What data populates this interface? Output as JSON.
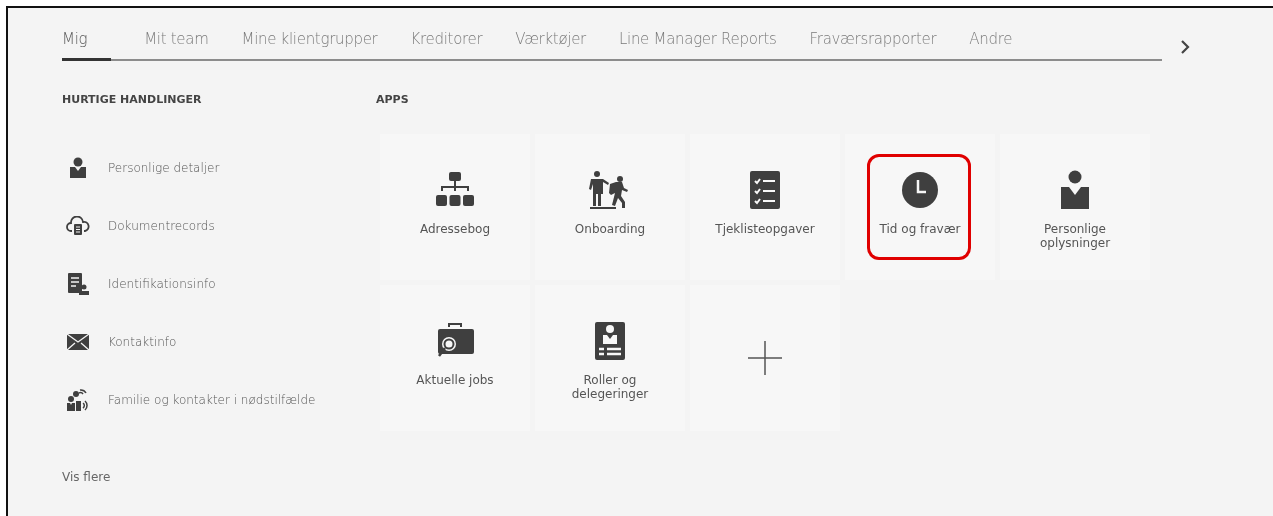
{
  "tabs": [
    {
      "label": "Mig",
      "selected": true
    },
    {
      "label": "Mit team",
      "selected": false
    },
    {
      "label": "Mine klientgrupper",
      "selected": false
    },
    {
      "label": "Kreditorer",
      "selected": false
    },
    {
      "label": "Værktøjer",
      "selected": false
    },
    {
      "label": "Line Manager Reports",
      "selected": false
    },
    {
      "label": "Fraværsrapporter",
      "selected": false
    },
    {
      "label": "Andre",
      "selected": false
    }
  ],
  "quick_actions": {
    "heading": "HURTIGE HANDLINGER",
    "items": [
      {
        "label": "Personlige detaljer"
      },
      {
        "label": "Dokumentrecords"
      },
      {
        "label": "Identifikationsinfo"
      },
      {
        "label": "Kontaktinfo"
      },
      {
        "label": "Familie og kontakter i nødstilfælde"
      }
    ],
    "more": "Vis flere"
  },
  "apps": {
    "heading": "APPS",
    "items": [
      {
        "kind": "app",
        "label": "Adressebog",
        "highlighted": false
      },
      {
        "kind": "app",
        "label": "Onboarding",
        "highlighted": false
      },
      {
        "kind": "app",
        "label": "Tjeklisteopgaver",
        "highlighted": false
      },
      {
        "kind": "app",
        "label": "Tid og fravær",
        "highlighted": true
      },
      {
        "kind": "app",
        "label": "Personlige oplysninger",
        "highlighted": false
      },
      {
        "kind": "app",
        "label": "Aktuelle jobs",
        "highlighted": false
      },
      {
        "kind": "app",
        "label": "Roller og delegeringer",
        "highlighted": false
      },
      {
        "kind": "add"
      }
    ]
  }
}
